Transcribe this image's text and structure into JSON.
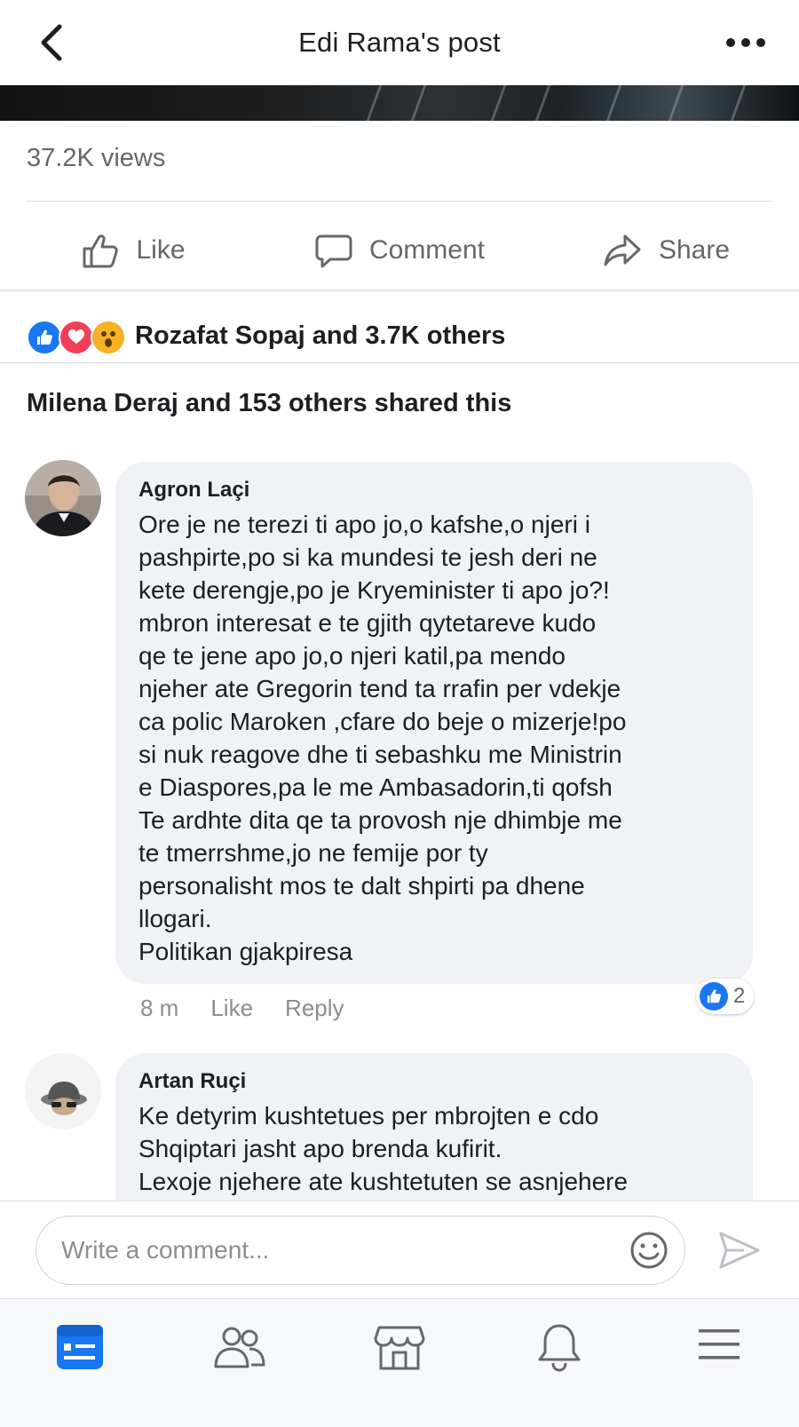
{
  "header": {
    "title": "Edi Rama's post"
  },
  "post": {
    "views": "37.2K views",
    "actions": {
      "like": "Like",
      "comment": "Comment",
      "share": "Share"
    },
    "reactions_text": "Rozafat Sopaj and 3.7K others",
    "reaction_icons": [
      "like-icon",
      "love-icon",
      "wow-icon"
    ],
    "shared_text": "Milena Deraj and 153 others shared this"
  },
  "comments": [
    {
      "author": "Agron Laçi",
      "text": "Ore je ne terezi ti apo jo,o kafshe,o njeri i\npashpirte,po si ka mundesi te jesh deri ne\nkete derengje,po je Kryeminister ti apo jo?!\nmbron interesat e te gjith qytetareve kudo\nqe te jene apo jo,o njeri katil,pa mendo\nnjeher ate Gregorin tend ta rrafin per vdekje\nca polic Maroken ,cfare do beje o mizerje!po\nsi nuk reagove dhe ti sebashku me Ministrin\ne Diaspores,pa le me Ambasadorin,ti qofsh\nTe ardhte dita qe ta provosh nje dhimbje me\nte tmerrshme,jo ne femije por ty\npersonalisht mos te dalt shpirti pa dhene\nllogari.\nPolitikan gjakpiresa",
      "time": "8 m",
      "like_label": "Like",
      "reply_label": "Reply",
      "reaction_count": "2"
    },
    {
      "author": "Artan Ruçi",
      "text": "Ke detyrim kushtetues per mbrojten e cdo\nShqiptari jasht apo brenda kufirit.\nLexoje njehere ate kushtetuten se asnjehere"
    }
  ],
  "composer": {
    "placeholder": "Write a comment..."
  },
  "bottom_nav": [
    "news-feed-icon",
    "friends-icon",
    "marketplace-icon",
    "notifications-icon",
    "menu-icon"
  ],
  "colors": {
    "accent": "#1877f2",
    "love": "#f33e58",
    "wow": "#f7b125",
    "secondary_text": "#65676b",
    "bubble": "#f0f2f5"
  }
}
